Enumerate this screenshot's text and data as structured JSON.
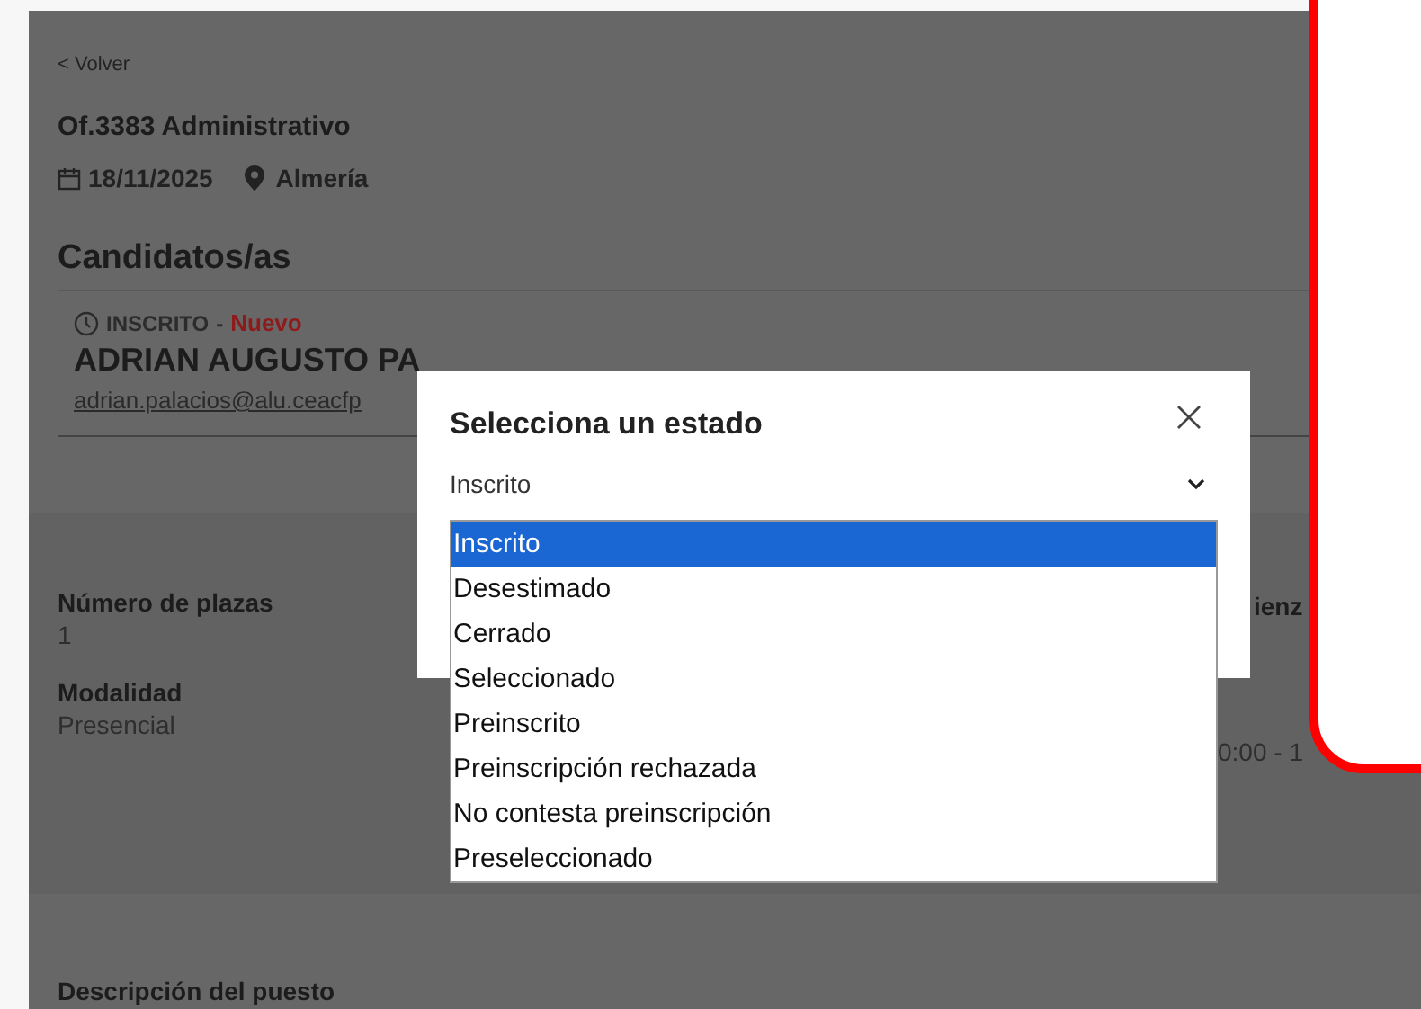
{
  "back_link": "< Volver",
  "offer": {
    "title": "Of.3383 Administrativo",
    "date": "18/11/2025",
    "location": "Almería"
  },
  "candidates": {
    "heading": "Candidatos/as",
    "items": [
      {
        "status": "INSCRITO",
        "separator": "-",
        "tag": "Nuevo",
        "name": "ADRIAN AUGUSTO PA",
        "email": "adrian.palacios@alu.ceacfp"
      }
    ]
  },
  "details": {
    "fields": [
      {
        "label": "Número de plazas",
        "value": "1"
      },
      {
        "label": "Modalidad",
        "value": "Presencial"
      }
    ],
    "column_2": {
      "label": "ienz",
      "value": "0:00 - 1"
    }
  },
  "description": {
    "heading": "Descripción del puesto"
  },
  "modal": {
    "title": "Selecciona un estado",
    "select": {
      "value": "Inscrito",
      "options": [
        {
          "label": "Inscrito",
          "selected": true
        },
        {
          "label": "Desestimado",
          "selected": false
        },
        {
          "label": "Cerrado",
          "selected": false
        },
        {
          "label": "Seleccionado",
          "selected": false
        },
        {
          "label": "Preinscrito",
          "selected": false
        },
        {
          "label": "Preinscripción rechazada",
          "selected": false
        },
        {
          "label": "No contesta preinscripción",
          "selected": false
        },
        {
          "label": "Preseleccionado",
          "selected": false
        }
      ]
    }
  }
}
